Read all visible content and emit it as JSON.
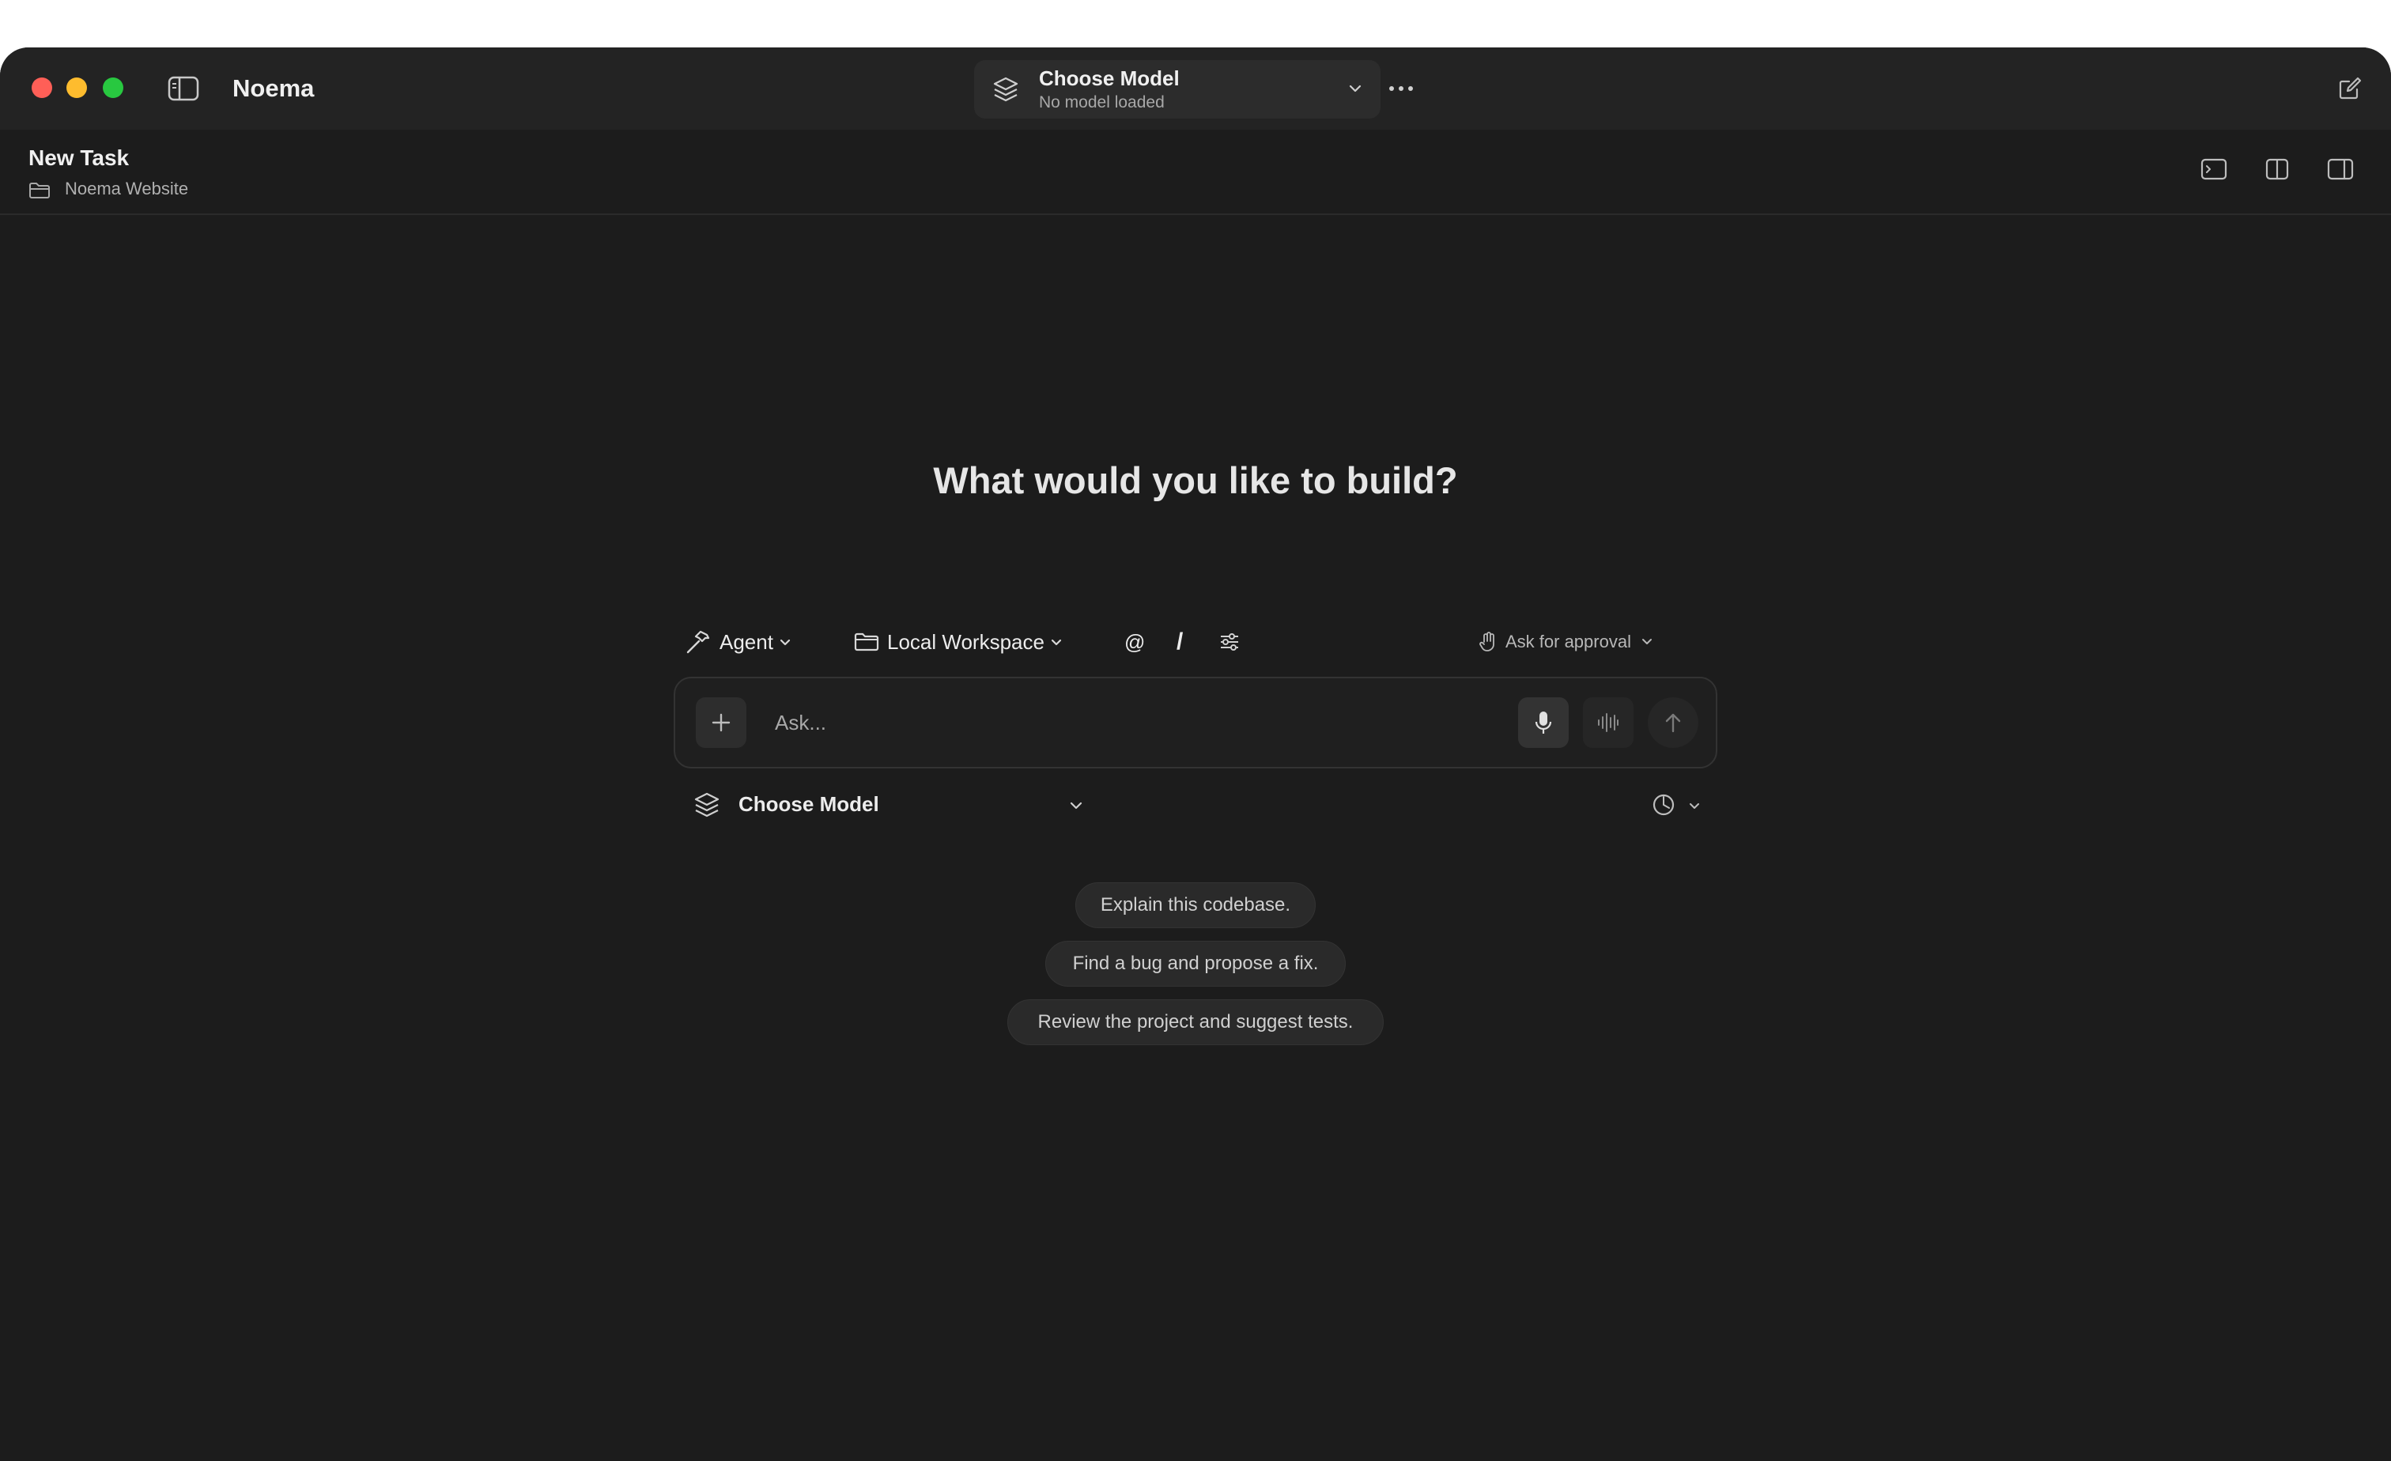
{
  "app": {
    "title": "Noema"
  },
  "model_picker": {
    "title": "Choose Model",
    "subtitle": "No model loaded"
  },
  "task": {
    "title": "New Task",
    "folder": "Noema Website"
  },
  "main": {
    "headline": "What would you like to build?",
    "toolbar": {
      "agent_label": "Agent",
      "workspace_label": "Local Workspace",
      "mention_symbol": "@",
      "command_symbol": "/",
      "approval_label": "Ask for approval"
    },
    "input": {
      "placeholder": "Ask..."
    },
    "model_row": {
      "label": "Choose Model"
    },
    "suggestions": [
      "Explain this codebase.",
      "Find a bug and propose a fix.",
      "Review the project and suggest tests."
    ]
  },
  "icons": {
    "sidebar_toggle": "sidebar-icon",
    "model": "layers-icon",
    "more": "ellipsis-icon",
    "compose": "compose-icon",
    "terminal": "terminal-icon",
    "split": "split-view-icon",
    "right_panel": "right-panel-icon",
    "agent": "hammer-icon",
    "workspace": "folder-icon",
    "settings": "sliders-icon",
    "approval": "hand-icon",
    "mic": "microphone-icon",
    "voice": "waveform-icon",
    "send": "arrow-up-icon",
    "usage": "gauge-icon"
  },
  "colors": {
    "window_bg": "#1c1c1c",
    "titlebar_bg": "#232323",
    "close": "#ff5f57",
    "minimize": "#febc2e",
    "zoom": "#28c840"
  }
}
